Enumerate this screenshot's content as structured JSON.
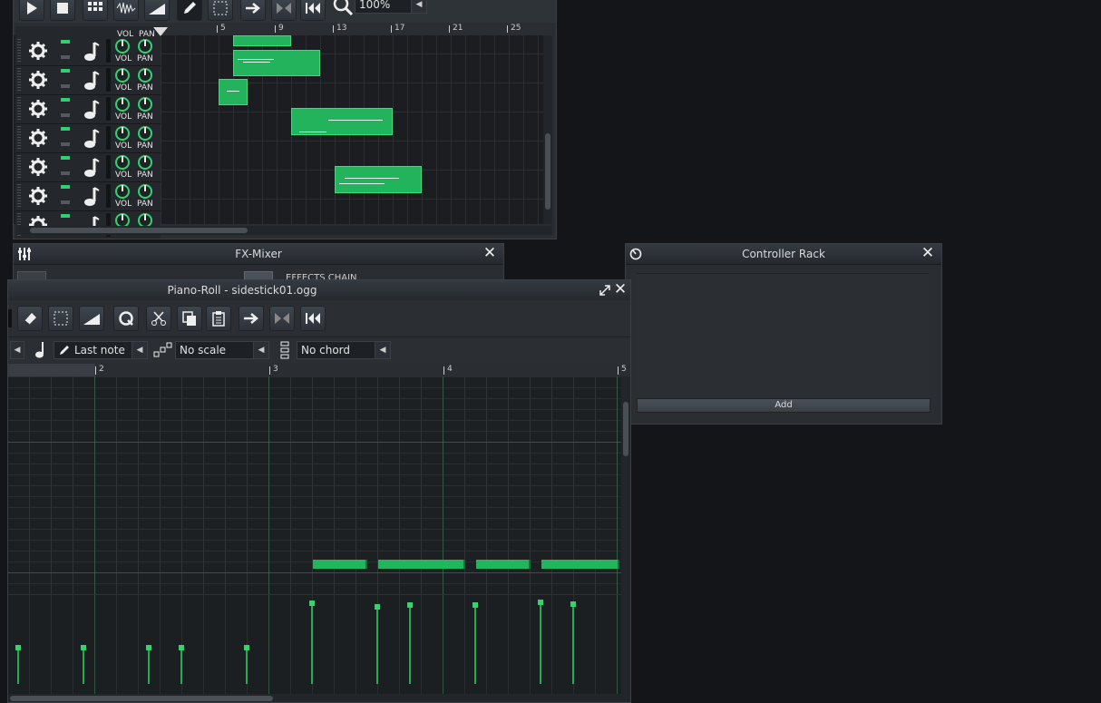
{
  "song_editor": {
    "zoom": "100%",
    "timeline_ticks": [
      "5",
      "9",
      "13",
      "17",
      "21",
      "25"
    ],
    "track_labels": {
      "vol": "VOL",
      "pan": "PAN"
    },
    "tracks": 7
  },
  "fx_mixer": {
    "title": "FX-Mixer",
    "effects_chain": "EFFECTS CHAIN"
  },
  "controller_rack": {
    "title": "Controller Rack",
    "add_label": "Add"
  },
  "piano_roll": {
    "title": "Piano-Roll - sidestick01.ogg",
    "note_length": "Last note",
    "scale": "No scale",
    "chord": "No chord",
    "bar_ticks": [
      "2",
      "3",
      "4",
      "5"
    ]
  },
  "colors": {
    "accent": "#22b35c",
    "background": "#141518",
    "panel": "#2a2e33"
  }
}
